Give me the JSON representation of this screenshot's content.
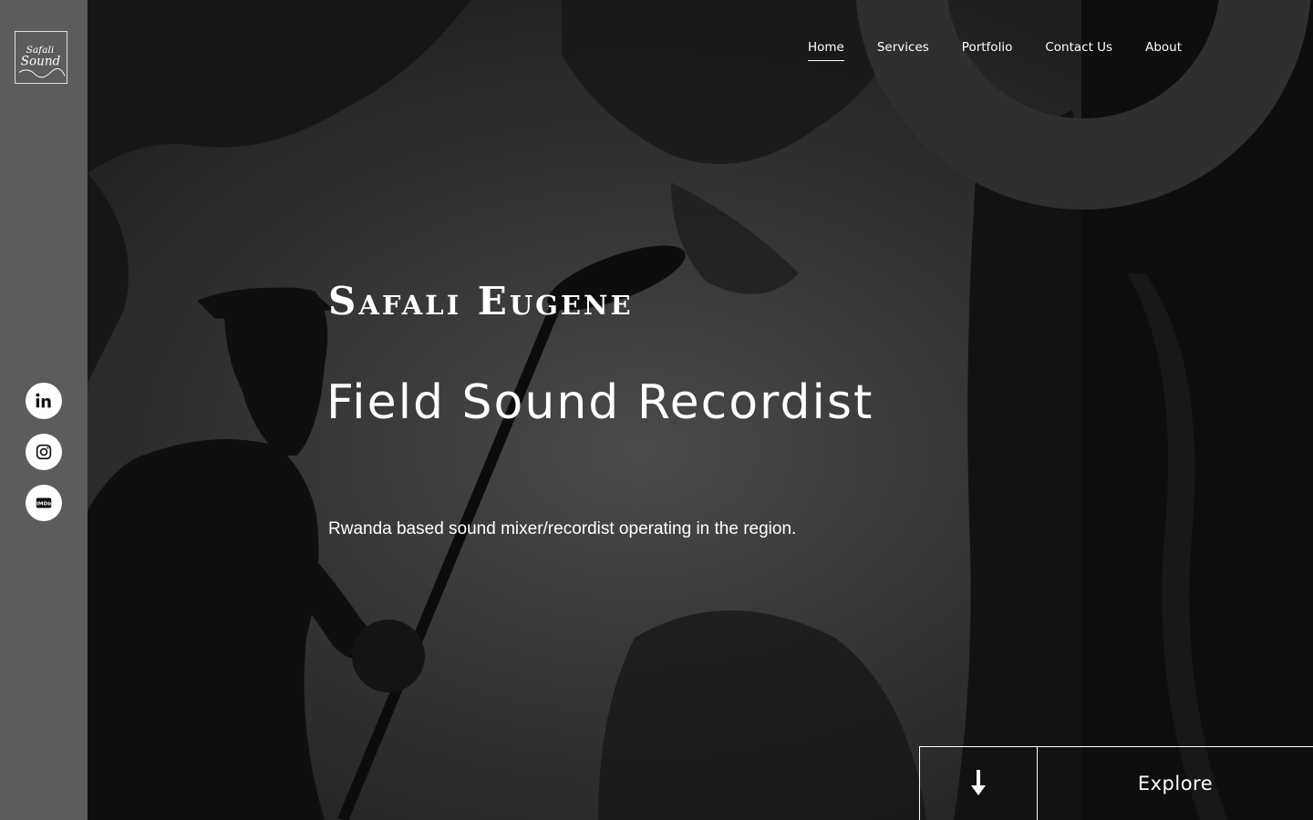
{
  "brand": {
    "logo_text": "Safali Sound"
  },
  "nav": {
    "items": [
      {
        "label": "Home",
        "active": true
      },
      {
        "label": "Services",
        "active": false
      },
      {
        "label": "Portfolio",
        "active": false
      },
      {
        "label": "Contact Us",
        "active": false
      },
      {
        "label": "About",
        "active": false
      }
    ]
  },
  "socials": [
    {
      "icon": "linkedin-icon"
    },
    {
      "icon": "instagram-icon"
    },
    {
      "icon": "imdb-icon",
      "text": "IMDb"
    }
  ],
  "hero": {
    "name": "Safali Eugene",
    "role": "Field Sound Recordist",
    "tagline": "Rwanda based sound mixer/recordist operating in the region."
  },
  "explore": {
    "label": "Explore",
    "icon": "arrow-down-icon"
  },
  "colors": {
    "sidebar": "#5c5c5c",
    "background": "#232323",
    "text": "#ffffff"
  }
}
